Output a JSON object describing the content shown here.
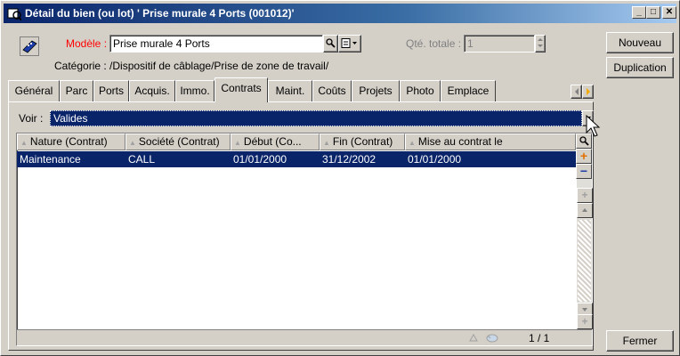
{
  "window": {
    "title": "Détail du bien (ou lot) ' Prise murale 4 Ports (001012)'",
    "minimize": "_",
    "maximize": "□",
    "close": "✕"
  },
  "form": {
    "modele_label": "Modèle :",
    "modele_value": "Prise murale 4 Ports",
    "qte_label": "Qté. totale :",
    "qte_value": "1",
    "categorie_text": "Catégorie : /Dispositif de câblage/Prise de zone de travail/"
  },
  "buttons": {
    "nouveau": "Nouveau",
    "duplication": "Duplication",
    "fermer": "Fermer"
  },
  "tabs": [
    {
      "label": "Général"
    },
    {
      "label": "Parc"
    },
    {
      "label": "Ports"
    },
    {
      "label": "Acquis."
    },
    {
      "label": "Immo."
    },
    {
      "label": "Contrats"
    },
    {
      "label": "Maint."
    },
    {
      "label": "Coûts"
    },
    {
      "label": "Projets"
    },
    {
      "label": "Photo"
    },
    {
      "label": "Emplace"
    }
  ],
  "active_tab": "Contrats",
  "filter": {
    "label": "Voir :",
    "value": "Valides"
  },
  "table": {
    "columns": [
      "Nature (Contrat)",
      "Société (Contrat)",
      "Début (Co...",
      "Fin (Contrat)",
      "Mise au contrat le"
    ],
    "rows": [
      {
        "nature": "Maintenance",
        "societe": "CALL",
        "debut": "01/01/2000",
        "fin": "31/12/2002",
        "mise": "01/01/2000"
      }
    ],
    "page_indicator": "1 / 1"
  },
  "colors": {
    "selection": "#0a246a",
    "title_start": "#0a246a",
    "required_label": "#ff0000"
  }
}
